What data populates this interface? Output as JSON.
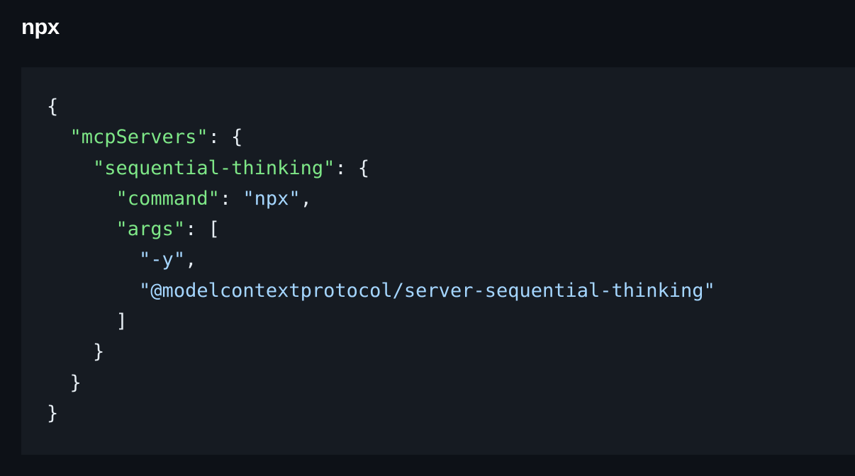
{
  "section": {
    "heading": "npx"
  },
  "code": {
    "language": "json",
    "colors": {
      "background": "#161b22",
      "key": "#7ee787",
      "string": "#a5d6ff",
      "punctuation": "#e6edf3"
    },
    "l1": "{",
    "l2_key": "\"mcpServers\"",
    "l2_tail": ": {",
    "l3_key": "\"sequential-thinking\"",
    "l3_tail": ": {",
    "l4_key": "\"command\"",
    "l4_sep": ": ",
    "l4_val": "\"npx\"",
    "l4_tail": ",",
    "l5_key": "\"args\"",
    "l5_tail": ": [",
    "l6_val": "\"-y\"",
    "l6_tail": ",",
    "l7_val": "\"@modelcontextprotocol/server-sequential-thinking\"",
    "l8": "]",
    "l9": "}",
    "l10": "}",
    "l11": "}"
  }
}
